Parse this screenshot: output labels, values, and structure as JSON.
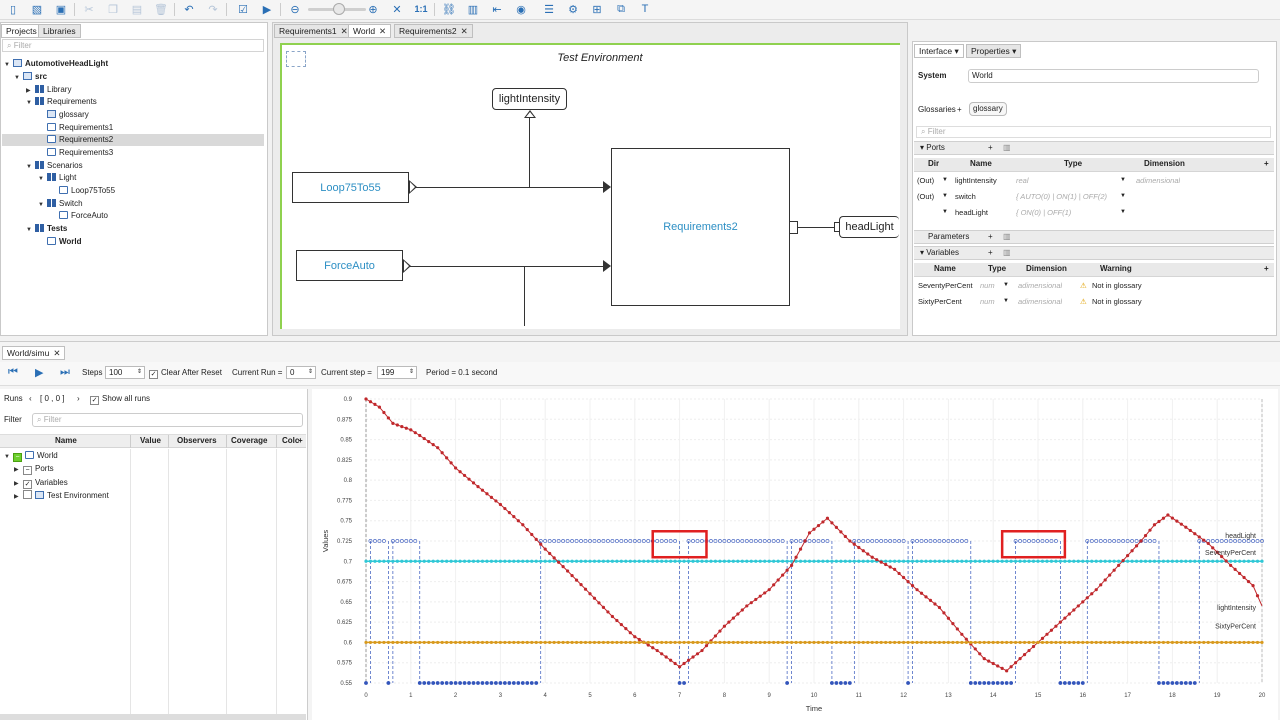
{
  "toolbar": {
    "icons": [
      "new-file-icon",
      "new-project-icon",
      "save-icon",
      "cut-icon",
      "copy-icon",
      "paste-icon",
      "delete-icon",
      "undo-icon",
      "redo-icon",
      "check-icon",
      "run-icon",
      "zoom-out-icon",
      "zoom-in-icon",
      "fit-icon",
      "zoom-reset-icon",
      "link-icon",
      "document-icon",
      "arrow-left-icon",
      "eye-icon",
      "list-icon",
      "layout-icon",
      "hierarchy-icon",
      "copy-model-icon",
      "text-icon"
    ],
    "zoom_reset_label": "1:1"
  },
  "project_panel": {
    "tabs": [
      "Projects",
      "Libraries"
    ],
    "filter_placeholder": "Filter",
    "tree": [
      {
        "label": "AutomotiveHeadLight",
        "bold": true
      },
      {
        "label": "src",
        "bold": true
      },
      {
        "label": "Library"
      },
      {
        "label": "Requirements"
      },
      {
        "label": "glossary"
      },
      {
        "label": "Requirements1"
      },
      {
        "label": "Requirements2"
      },
      {
        "label": "Requirements3"
      },
      {
        "label": "Scenarios"
      },
      {
        "label": "Light"
      },
      {
        "label": "Loop75To55"
      },
      {
        "label": "Switch"
      },
      {
        "label": "ForceAuto"
      },
      {
        "label": "Tests",
        "bold": true
      },
      {
        "label": "World",
        "bold": true
      }
    ]
  },
  "editor": {
    "tabs": [
      "Requirements1",
      "World",
      "Requirements2"
    ],
    "diagram_title": "Test Environment",
    "blocks": {
      "light_intensity": "lightIntensity",
      "loop": "Loop75To55",
      "force_auto": "ForceAuto",
      "requirements2": "Requirements2",
      "head_light": "headLight"
    }
  },
  "properties": {
    "tabs": [
      "Interface",
      "Properties"
    ],
    "system_label": "System",
    "system_value": "World",
    "glossaries_label": "Glossaries",
    "glossaries_add": "+",
    "glossary_chip": "glossary",
    "filter_placeholder": "Filter",
    "ports_section": "Ports",
    "ports_headers": [
      "Dir",
      "Name",
      "Type",
      "Dimension"
    ],
    "ports": [
      {
        "dir": "(Out)",
        "name": "lightIntensity",
        "type": "real",
        "dimension": "adimensional"
      },
      {
        "dir": "(Out)",
        "name": "switch",
        "type": "{ AUTO(0) | ON(1) | OFF(2)",
        "dimension": ""
      },
      {
        "dir": "",
        "name": "headLight",
        "type": "{ ON(0) | OFF(1)",
        "dimension": ""
      }
    ],
    "parameters_section": "Parameters",
    "variables_section": "Variables",
    "variables_headers": [
      "Name",
      "Type",
      "Dimension",
      "Warning"
    ],
    "variables": [
      {
        "name": "SeventyPerCent",
        "type": "num",
        "dimension": "adimensional",
        "warning": "Not in glossary"
      },
      {
        "name": "SixtyPerCent",
        "type": "num",
        "dimension": "adimensional",
        "warning": "Not in glossary"
      }
    ]
  },
  "sim": {
    "tab_label": "World/simu",
    "steps_label": "Steps",
    "steps_value": "100",
    "clear_label": "Clear After Reset",
    "current_run_label": "Current Run =",
    "current_run_value": "0",
    "current_step_label": "Current step =",
    "current_step_value": "199",
    "period_label": "Period = 0.1 second",
    "runs_label": "Runs",
    "runs_range": "[ 0 , 0 ]",
    "show_all_runs": "Show all runs",
    "filter_label": "Filter",
    "filter_placeholder": "Filter",
    "table_headers": [
      "Name",
      "Value",
      "Observers",
      "Coverage",
      "Colc"
    ],
    "table_rows": [
      {
        "label": "World"
      },
      {
        "label": "Ports"
      },
      {
        "label": "Variables"
      },
      {
        "label": "Test Environment"
      }
    ]
  },
  "chart_data": {
    "type": "line",
    "xlabel": "Time",
    "ylabel": "Values",
    "xlim": [
      0,
      20
    ],
    "ylim": [
      0.55,
      0.9
    ],
    "xticks": [
      0,
      1,
      2,
      3,
      4,
      5,
      6,
      7,
      8,
      9,
      10,
      11,
      12,
      13,
      14,
      15,
      16,
      17,
      18,
      19,
      20
    ],
    "yticks": [
      0.55,
      0.575,
      0.6,
      0.625,
      0.65,
      0.675,
      0.7,
      0.725,
      0.75,
      0.775,
      0.8,
      0.825,
      0.85,
      0.875,
      0.9
    ],
    "series": [
      {
        "name": "headLight",
        "color": "#3355bb",
        "kind": "binary",
        "high": 0.725,
        "low": 0.55,
        "high_segments": [
          [
            0.1,
            0.4
          ],
          [
            0.6,
            1.1
          ],
          [
            3.9,
            4.6
          ],
          [
            4.6,
            6.9
          ],
          [
            7.2,
            8.9
          ],
          [
            8.9,
            9.3
          ],
          [
            9.5,
            10.3
          ],
          [
            10.9,
            12.0
          ],
          [
            12.2,
            13.4
          ],
          [
            14.5,
            15.4
          ],
          [
            16.1,
            17.6
          ],
          [
            18.6,
            20.0
          ]
        ]
      },
      {
        "name": "SeventyPerCent",
        "color": "#30c8d6",
        "kind": "constant",
        "value": 0.7
      },
      {
        "name": "lightIntensity",
        "color": "#c0282c",
        "kind": "line",
        "x": [
          0,
          0.3,
          0.6,
          1.0,
          1.2,
          1.6,
          2.0,
          2.5,
          3.0,
          3.5,
          4.0,
          4.5,
          5.0,
          5.5,
          6.0,
          6.5,
          7.0,
          7.5,
          8.0,
          8.5,
          9.0,
          9.5,
          9.9,
          10.3,
          10.8,
          11.3,
          11.8,
          12.3,
          12.8,
          13.3,
          13.8,
          14.3,
          14.8,
          15.3,
          15.8,
          16.3,
          16.8,
          17.3,
          17.6,
          17.9,
          18.3,
          18.8,
          19.3,
          19.8,
          20.0
        ],
        "y": [
          0.9,
          0.89,
          0.87,
          0.862,
          0.855,
          0.84,
          0.815,
          0.792,
          0.77,
          0.745,
          0.715,
          0.688,
          0.66,
          0.632,
          0.607,
          0.59,
          0.57,
          0.59,
          0.62,
          0.645,
          0.665,
          0.695,
          0.735,
          0.753,
          0.725,
          0.705,
          0.69,
          0.665,
          0.643,
          0.61,
          0.58,
          0.565,
          0.59,
          0.615,
          0.64,
          0.665,
          0.695,
          0.725,
          0.745,
          0.757,
          0.742,
          0.722,
          0.695,
          0.67,
          0.645
        ]
      },
      {
        "name": "SixtyPerCent",
        "color": "#d89a1e",
        "kind": "constant",
        "value": 0.6
      }
    ],
    "annotations": [
      "headLight",
      "SeventyPerCent",
      "lightIntensity",
      "SixtyPerCent"
    ],
    "highlight_boxes_x": [
      [
        6.4,
        7.6
      ],
      [
        14.2,
        15.6
      ]
    ]
  }
}
